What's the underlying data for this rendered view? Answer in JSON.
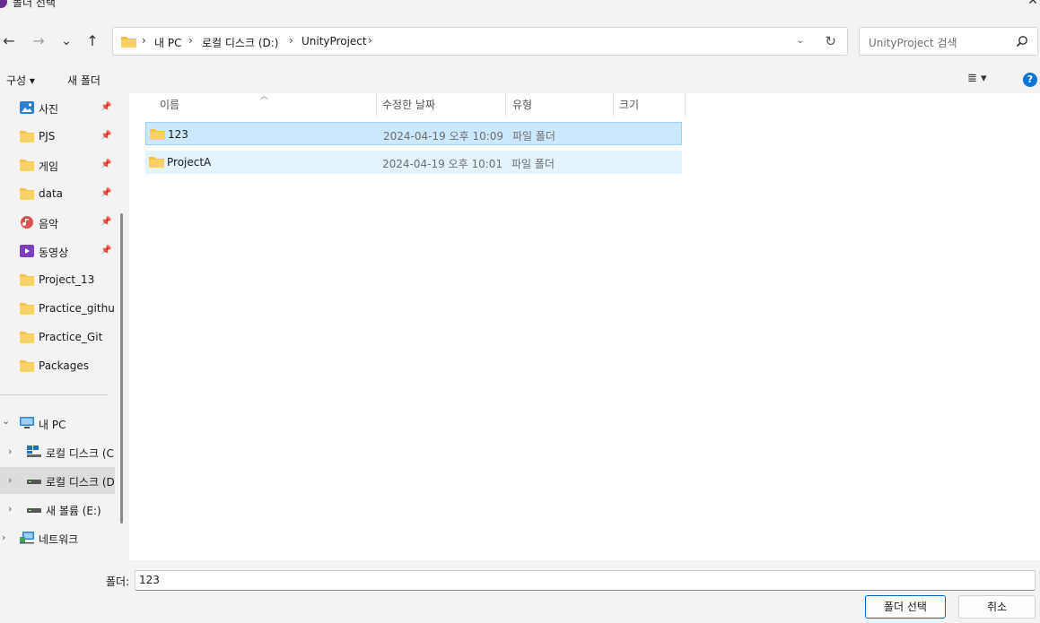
{
  "window": {
    "title": "폴더 선택",
    "close": "✕"
  },
  "nav": {
    "back": "←",
    "forward": "→",
    "recent": "⌄",
    "up": "↑"
  },
  "address": {
    "crumbs": [
      "내 PC",
      "로컬 디스크 (D:)",
      "UnityProject"
    ],
    "separator": "›",
    "dropdown": "⌄",
    "refresh": "↻"
  },
  "search": {
    "placeholder": "UnityProject 검색"
  },
  "toolbar": {
    "organize": "구성 ▾",
    "new_folder": "새 폴더",
    "view": "≣ ▾",
    "help": "?"
  },
  "sidebar": {
    "quick": [
      {
        "label": "사진",
        "icon": "photo-icon",
        "pinned": true
      },
      {
        "label": "PJS",
        "icon": "folder-icon",
        "pinned": true
      },
      {
        "label": "게임",
        "icon": "folder-icon",
        "pinned": true
      },
      {
        "label": "data",
        "icon": "folder-icon",
        "pinned": true
      },
      {
        "label": "음악",
        "icon": "music-icon",
        "pinned": true
      },
      {
        "label": "동영상",
        "icon": "video-icon",
        "pinned": true
      },
      {
        "label": "Project_13",
        "icon": "folder-icon",
        "pinned": false
      },
      {
        "label": "Practice_github",
        "icon": "folder-icon",
        "pinned": false
      },
      {
        "label": "Practice_Git",
        "icon": "folder-icon",
        "pinned": false
      },
      {
        "label": "Packages",
        "icon": "folder-icon",
        "pinned": false
      }
    ],
    "pc": "내 PC",
    "drives": [
      "로컬 디스크 (C",
      "로컬 디스크 (D",
      "새 볼륨 (E:)"
    ],
    "network": "네트워크"
  },
  "columns": {
    "name": "이름",
    "date": "수정한 날짜",
    "type": "유형",
    "size": "크기"
  },
  "files": [
    {
      "name": "123",
      "date": "2024-04-19 오후 10:09",
      "type": "파일 폴더"
    },
    {
      "name": "ProjectA",
      "date": "2024-04-19 오후 10:01",
      "type": "파일 폴더"
    }
  ],
  "footer": {
    "folder_label": "폴더:",
    "folder_value": "123",
    "select_button": "폴더 선택",
    "cancel_button": "취소"
  },
  "colors": {
    "folder": "#f5c242",
    "selected_row": "#cce8ff",
    "accent": "#0067c0"
  }
}
